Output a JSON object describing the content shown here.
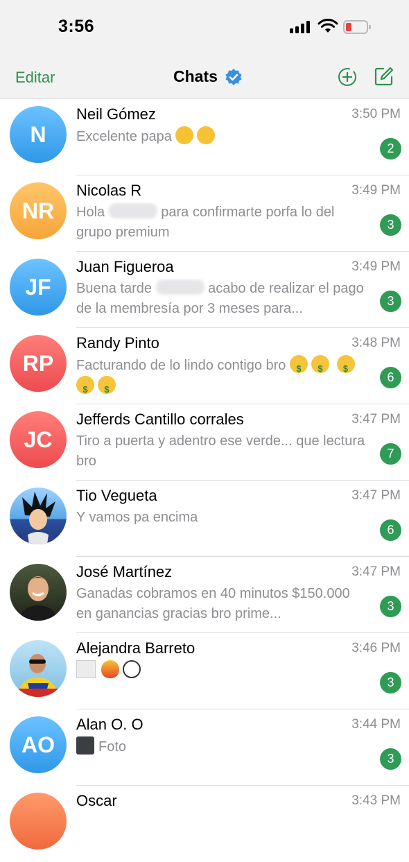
{
  "status": {
    "time": "3:56"
  },
  "nav": {
    "edit": "Editar",
    "title": "Chats"
  },
  "icons": {
    "verified": "verified-check-icon",
    "new_group": "add-circle-icon",
    "compose": "compose-icon"
  },
  "colors": {
    "accent": "#2f8f4e",
    "badge": "#2f9b55",
    "battery_low": "#e8443b"
  },
  "chats": [
    {
      "initials": "N",
      "name": "Neil Gómez",
      "time": "3:50 PM",
      "preview": "Excelente papa",
      "unread": "2"
    },
    {
      "initials": "NR",
      "name": "Nicolas R",
      "time": "3:49 PM",
      "preview_a": "Hola",
      "preview_b": "para confirmarte porfa lo del grupo premium",
      "unread": "3"
    },
    {
      "initials": "JF",
      "name": "Juan Figueroa",
      "time": "3:49 PM",
      "preview_a": "Buena tarde",
      "preview_b": "acabo de realizar el pago de la membresía por 3 meses para...",
      "unread": "3"
    },
    {
      "initials": "RP",
      "name": "Randy Pinto",
      "time": "3:48 PM",
      "preview": "Facturando de lo lindo contigo bro",
      "unread": "6"
    },
    {
      "initials": "JC",
      "name": "Jefferds Cantillo corrales",
      "time": "3:47 PM",
      "preview": "Tiro a puerta y adentro ese verde... que lectura bro",
      "unread": "7"
    },
    {
      "name": "Tio Vegueta",
      "time": "3:47 PM",
      "preview": "Y vamos pa encima",
      "unread": "6"
    },
    {
      "name": "José Martínez",
      "time": "3:47 PM",
      "preview": "Ganadas cobramos en 40 minutos $150.000 en ganancias gracias bro prime...",
      "unread": "3"
    },
    {
      "name": "Alejandra Barreto",
      "time": "3:46 PM",
      "unread": "3"
    },
    {
      "initials": "AO",
      "name": "Alan O. O",
      "time": "3:44 PM",
      "preview": "Foto",
      "unread": "3"
    },
    {
      "name": "Oscar",
      "time": "3:43 PM"
    }
  ]
}
